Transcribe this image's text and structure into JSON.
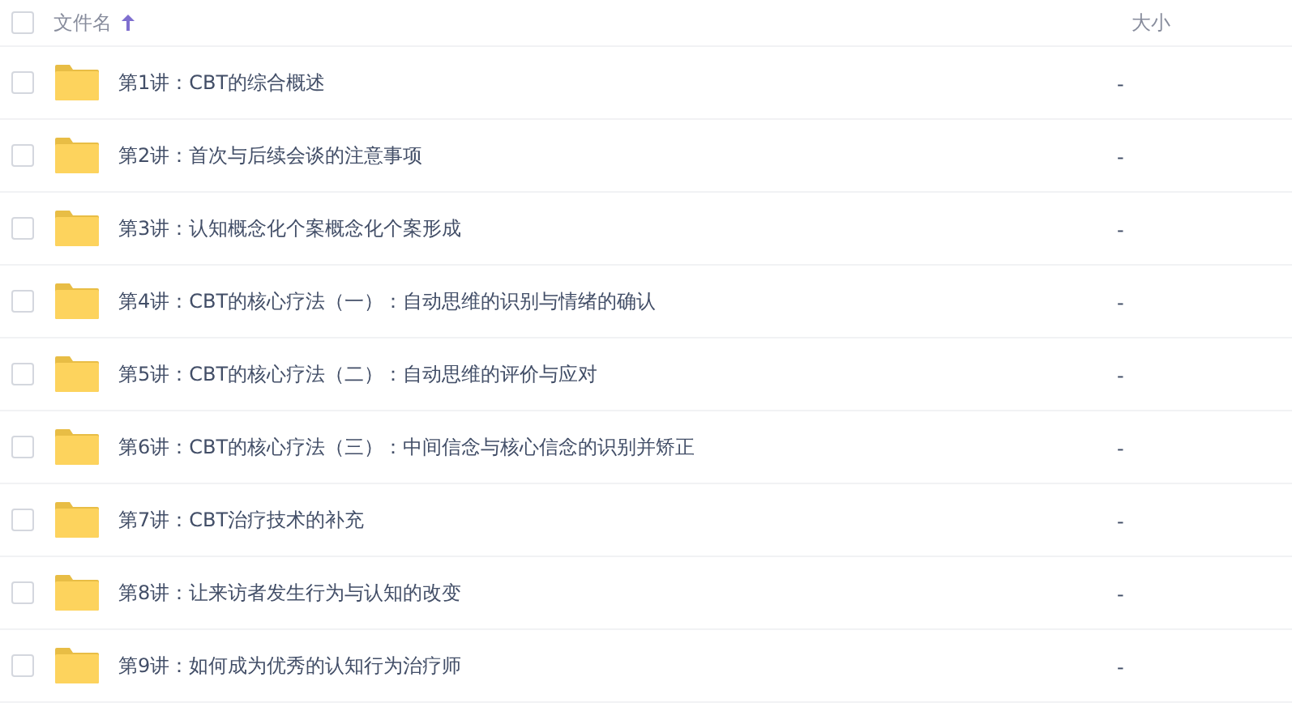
{
  "header": {
    "checked": false,
    "name_label": "文件名",
    "size_label": "大小"
  },
  "files": [
    {
      "name": "第1讲：CBT的综合概述",
      "size": "-",
      "checked": false
    },
    {
      "name": "第2讲：首次与后续会谈的注意事项",
      "size": "-",
      "checked": false
    },
    {
      "name": "第3讲：认知概念化个案概念化个案形成",
      "size": "-",
      "checked": false
    },
    {
      "name": "第4讲：CBT的核心疗法（一）：自动思维的识别与情绪的确认",
      "size": "-",
      "checked": false
    },
    {
      "name": "第5讲：CBT的核心疗法（二）：自动思维的评价与应对",
      "size": "-",
      "checked": false
    },
    {
      "name": "第6讲：CBT的核心疗法（三）：中间信念与核心信念的识别并矫正",
      "size": "-",
      "checked": false
    },
    {
      "name": "第7讲：CBT治疗技术的补充",
      "size": "-",
      "checked": false
    },
    {
      "name": "第8讲：让来访者发生行为与认知的改变",
      "size": "-",
      "checked": false
    },
    {
      "name": "第9讲：如何成为优秀的认知行为治疗师",
      "size": "-",
      "checked": false
    }
  ]
}
